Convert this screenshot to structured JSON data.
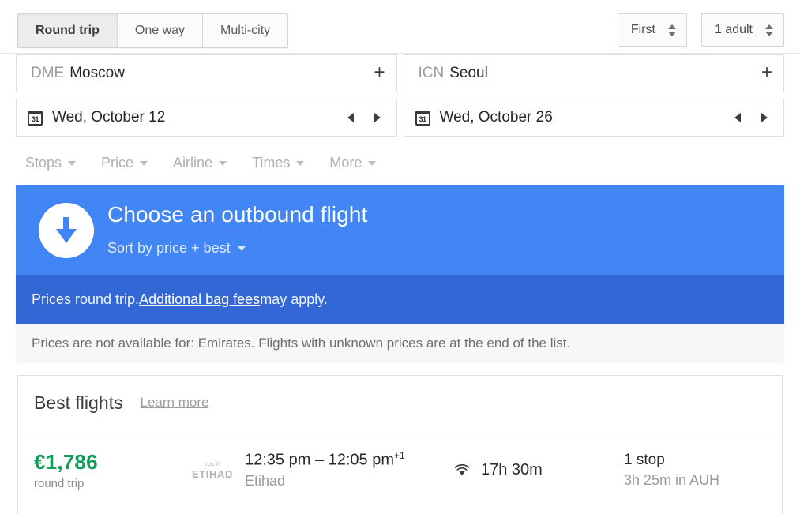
{
  "trip_tabs": [
    {
      "label": "Round trip",
      "active": true
    },
    {
      "label": "One way",
      "active": false
    },
    {
      "label": "Multi-city",
      "active": false
    }
  ],
  "cabin_class": {
    "value": "First",
    "icon": "stepper-arrows-icon"
  },
  "passengers": {
    "value": "1 adult",
    "icon": "stepper-arrows-icon"
  },
  "search": {
    "origin": {
      "code": "DME",
      "city": "Moscow",
      "add_icon": "plus-icon"
    },
    "destination": {
      "code": "ICN",
      "city": "Seoul",
      "add_icon": "plus-icon"
    },
    "depart_date": {
      "value": "Wed, October 12",
      "icon": "calendar-icon",
      "icon_label": "31",
      "prev_icon": "arrow-left-icon",
      "next_icon": "arrow-right-icon"
    },
    "return_date": {
      "value": "Wed, October 26",
      "icon": "calendar-icon",
      "icon_label": "31",
      "prev_icon": "arrow-left-icon",
      "next_icon": "arrow-right-icon"
    }
  },
  "filters": [
    {
      "label": "Stops"
    },
    {
      "label": "Price"
    },
    {
      "label": "Airline"
    },
    {
      "label": "Times"
    },
    {
      "label": "More"
    }
  ],
  "banner": {
    "icon": "download-arrow-icon",
    "title": "Choose an outbound flight",
    "sort_label": "Sort by price + best",
    "sort_caret": "chevron-down-icon",
    "bg_color": "#4285f4"
  },
  "bag_notice": {
    "prefix": "Prices round trip. ",
    "link": "Additional bag fees",
    "suffix": " may apply.",
    "bg_color": "#3367d6"
  },
  "price_notice": {
    "text": "Prices are not available for: Emirates. Flights with unknown prices are at the end of the list.",
    "bg_color": "#f7f7f7"
  },
  "results": {
    "section_title": "Best flights",
    "learn_more": "Learn more",
    "flights": [
      {
        "price": "€1,786",
        "price_color": "#0f9d58",
        "price_note": "round trip",
        "logo_arabic": "الاتحاد",
        "logo_name": "ETIHAD",
        "times": "12:35 pm – 12:05 pm",
        "day_offset": "+1",
        "airline": "Etihad",
        "wifi_icon": "wifi-icon",
        "duration": "17h 30m",
        "stops": "1 stop",
        "stops_detail": "3h 25m in AUH"
      }
    ]
  }
}
